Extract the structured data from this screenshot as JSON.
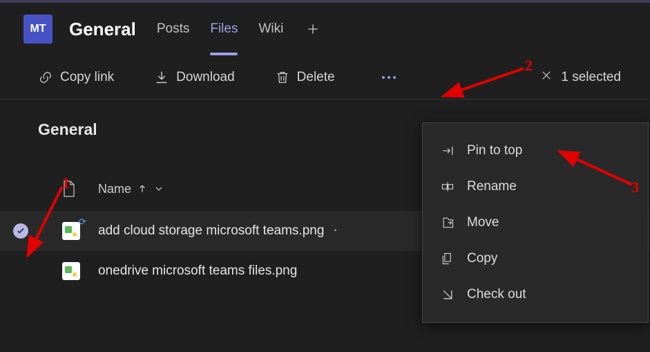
{
  "header": {
    "avatar_text": "MT",
    "channel_title": "General",
    "tabs": {
      "posts": "Posts",
      "files": "Files",
      "wiki": "Wiki"
    }
  },
  "toolbar": {
    "copy_link": "Copy link",
    "download": "Download",
    "delete": "Delete",
    "selected_text": "1 selected"
  },
  "body": {
    "folder_title": "General",
    "name_col": "Name"
  },
  "files": [
    {
      "name": "add cloud storage microsoft teams.png",
      "selected": true
    },
    {
      "name": "onedrive microsoft teams files.png",
      "selected": false
    }
  ],
  "menu": {
    "pin_to_top": "Pin to top",
    "rename": "Rename",
    "move": "Move",
    "copy": "Copy",
    "check_out": "Check out"
  },
  "annotations": {
    "n1": "1",
    "n2": "2",
    "n3": "3"
  }
}
